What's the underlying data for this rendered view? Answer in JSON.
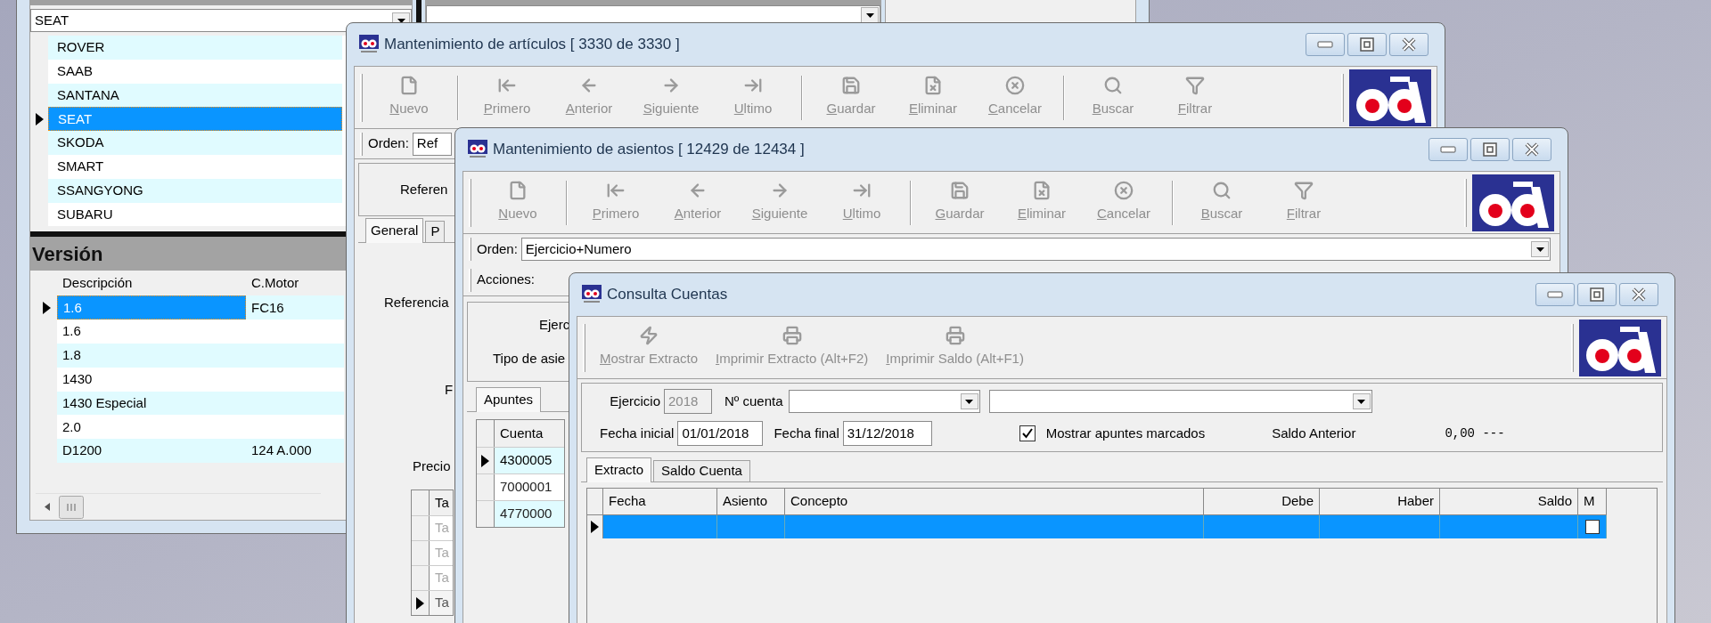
{
  "marcas_window": {
    "brand_combo": {
      "value": "SEAT"
    },
    "brands": [
      {
        "name": "ROVER",
        "selected": false
      },
      {
        "name": "SAAB",
        "selected": false
      },
      {
        "name": "SANTANA",
        "selected": false
      },
      {
        "name": "SEAT",
        "selected": true
      },
      {
        "name": "SKODA",
        "selected": false
      },
      {
        "name": "SMART",
        "selected": false
      },
      {
        "name": "SSANGYONG",
        "selected": false
      },
      {
        "name": "SUBARU",
        "selected": false
      }
    ],
    "version": {
      "title": "Versión",
      "columns": [
        "Descripción",
        "C.Motor"
      ],
      "rows": [
        {
          "descripcion": "1.6",
          "c_motor": "FC16",
          "selected": true
        },
        {
          "descripcion": "1.6",
          "selected": false
        },
        {
          "descripcion": "1.8",
          "selected": false
        },
        {
          "descripcion": "1430",
          "selected": false
        },
        {
          "descripcion": "1430 Especial",
          "selected": false
        },
        {
          "descripcion": "2.0",
          "selected": false
        },
        {
          "descripcion": "D1200",
          "c_motor": "124 A.000",
          "selected": false
        }
      ]
    }
  },
  "articulos_window": {
    "title": "Mantenimiento de artículos [ 3330 de 3330 ]",
    "toolbar_groups": [
      [
        {
          "label": "Nuevo",
          "kind": "new",
          "disabled": true
        }
      ],
      [
        {
          "label": "Primero",
          "kind": "first",
          "disabled": true
        },
        {
          "label": "Anterior",
          "kind": "prev",
          "disabled": true
        },
        {
          "label": "Siguiente",
          "kind": "next",
          "disabled": true
        },
        {
          "label": "Ultimo",
          "kind": "last",
          "disabled": true
        }
      ],
      [
        {
          "label": "Guardar",
          "kind": "save",
          "disabled": true
        },
        {
          "label": "Eliminar",
          "kind": "delete",
          "disabled": true
        },
        {
          "label": "Cancelar",
          "kind": "cancel",
          "disabled": true
        }
      ],
      [
        {
          "label": "Buscar",
          "kind": "search",
          "disabled": true
        },
        {
          "label": "Filtrar",
          "kind": "filter",
          "disabled": true
        }
      ]
    ],
    "order": {
      "label": "Orden:",
      "value": "Ref"
    },
    "header_label": "Referen",
    "tabs": [
      {
        "label": "General",
        "selected": true
      },
      {
        "label": "P",
        "selected": false
      }
    ],
    "labels": [
      "Referencia",
      "F",
      "Precio"
    ],
    "grid": {
      "header": "Ta",
      "rows": [
        {
          "text": "Ta",
          "selected": false
        },
        {
          "text": "Ta",
          "selected": false
        },
        {
          "text": "Ta",
          "selected": false
        },
        {
          "text": "Ta",
          "selected": true
        }
      ]
    }
  },
  "asientos_window": {
    "title": "Mantenimiento de asientos [ 12429 de 12434 ]",
    "toolbar_groups": [
      [
        {
          "label": "Nuevo",
          "kind": "new",
          "disabled": true
        }
      ],
      [
        {
          "label": "Primero",
          "kind": "first",
          "disabled": true
        },
        {
          "label": "Anterior",
          "kind": "prev",
          "disabled": true
        },
        {
          "label": "Siguiente",
          "kind": "next",
          "disabled": true
        },
        {
          "label": "Ultimo",
          "kind": "last",
          "disabled": true
        }
      ],
      [
        {
          "label": "Guardar",
          "kind": "save",
          "disabled": true
        },
        {
          "label": "Eliminar",
          "kind": "delete",
          "disabled": true
        },
        {
          "label": "Cancelar",
          "kind": "cancel",
          "disabled": true
        }
      ],
      [
        {
          "label": "Buscar",
          "kind": "search",
          "disabled": true
        },
        {
          "label": "Filtrar",
          "kind": "filter",
          "disabled": true
        }
      ]
    ],
    "order": {
      "label": "Orden:",
      "value": "Ejercicio+Numero"
    },
    "actions_label": "Acciones:",
    "labels": [
      "Ejerc",
      "Tipo de asie"
    ],
    "tabs": [
      {
        "label": "Apuntes",
        "selected": true
      }
    ],
    "grid": {
      "header": "Cuenta",
      "rows": [
        {
          "text": "4300005",
          "selected": true
        },
        {
          "text": "7000001",
          "selected": false
        },
        {
          "text": "4770000",
          "selected": false
        }
      ]
    }
  },
  "consulta_window": {
    "title": "Consulta Cuentas",
    "toolbar": [
      {
        "label": "Mostrar Extracto",
        "kind": "lightning",
        "disabled": true
      },
      {
        "label": "Imprimir Extracto (Alt+F2)",
        "kind": "printer",
        "disabled": true
      },
      {
        "label": "Imprimir Saldo (Alt+F1)",
        "kind": "printer",
        "disabled": true
      }
    ],
    "ejercicio": {
      "label": "Ejercicio",
      "value": "2018",
      "disabled": true
    },
    "cuenta": {
      "label": "Nº cuenta"
    },
    "fecha_inicial": {
      "label": "Fecha inicial",
      "value": "01/01/2018"
    },
    "fecha_final": {
      "label": "Fecha final",
      "value": "31/12/2018"
    },
    "mostrar_marcados": {
      "label": "Mostrar apuntes marcados",
      "checked": true
    },
    "saldo_anterior": {
      "label": "Saldo Anterior",
      "value": "0,00 ---"
    },
    "tabs": [
      {
        "label": "Extracto",
        "selected": true
      },
      {
        "label": "Saldo Cuenta",
        "selected": false
      }
    ],
    "grid": {
      "columns": [
        "Fecha",
        "Asiento",
        "Concepto",
        "Debe",
        "Haber",
        "Saldo",
        "M"
      ],
      "rows": [
        {
          "selected": true,
          "marked": false
        }
      ]
    }
  }
}
